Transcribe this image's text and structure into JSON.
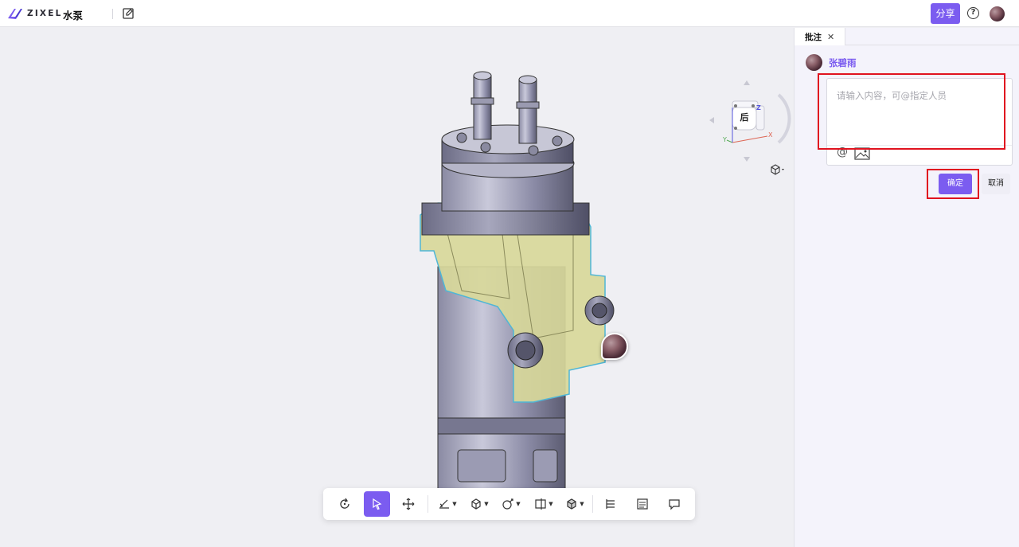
{
  "header": {
    "logo_text": "ZIXEL",
    "title": "水泵",
    "share_label": "分享",
    "help_label": "?"
  },
  "navcube": {
    "face_label": "后",
    "axis_x": "X",
    "axis_y": "Y",
    "axis_z": "Z"
  },
  "toolbar": {
    "items": [
      "rotate",
      "select",
      "pan",
      "measure",
      "section",
      "explode",
      "cut-plane",
      "display-mode",
      "structure-tree",
      "properties",
      "comment"
    ],
    "active": "select"
  },
  "panel": {
    "tab_label": "批注",
    "tab_close": "✕",
    "commenter_name": "张碧雨",
    "comment_placeholder": "请输入内容，可@指定人员",
    "at_symbol": "@",
    "confirm_label": "确定",
    "cancel_label": "取消"
  },
  "colors": {
    "accent": "#7b5cf0",
    "highlight_red": "#e0131f",
    "selection_fill": "#d8d89a"
  }
}
